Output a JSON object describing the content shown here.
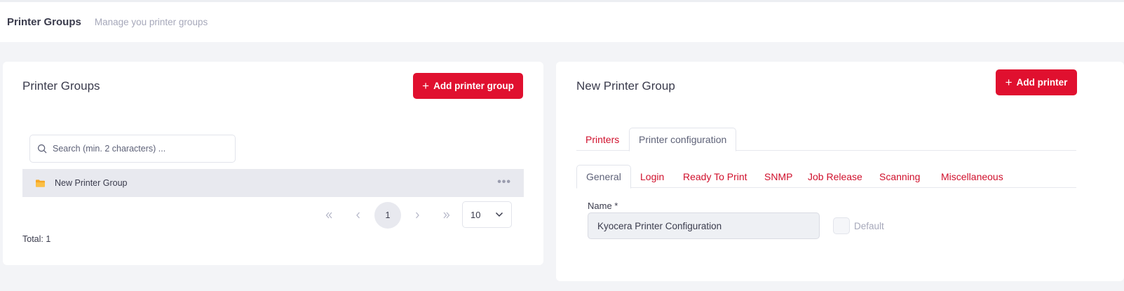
{
  "header": {
    "title": "Printer Groups",
    "subtitle": "Manage you printer groups"
  },
  "left_panel": {
    "title": "Printer Groups",
    "add_button_label": "Add printer group",
    "search": {
      "placeholder": "Search (min. 2 characters) ...",
      "value": ""
    },
    "groups": [
      {
        "name": "New Printer Group",
        "icon": "folder-icon"
      }
    ],
    "pagination": {
      "current_page": "1",
      "page_size": "10"
    },
    "total_label": "Total: 1"
  },
  "right_panel": {
    "title": "New Printer Group",
    "add_button_label": "Add printer",
    "main_tabs": [
      {
        "label": "Printers",
        "active": false
      },
      {
        "label": "Printer configuration",
        "active": true
      }
    ],
    "config_tabs": [
      {
        "label": "General",
        "active": true
      },
      {
        "label": "Login",
        "active": false
      },
      {
        "label": "Ready To Print",
        "active": false
      },
      {
        "label": "SNMP",
        "active": false
      },
      {
        "label": "Job Release",
        "active": false
      },
      {
        "label": "Scanning",
        "active": false
      },
      {
        "label": "Miscellaneous",
        "active": false
      }
    ],
    "form": {
      "name_label": "Name *",
      "name_value": "Kyocera Printer Configuration",
      "default_label": "Default",
      "default_checked": false
    }
  },
  "colors": {
    "accent": "#e0102f",
    "tab_link": "#d0102c",
    "folder": "#f6a623",
    "background": "#f3f4f7"
  }
}
